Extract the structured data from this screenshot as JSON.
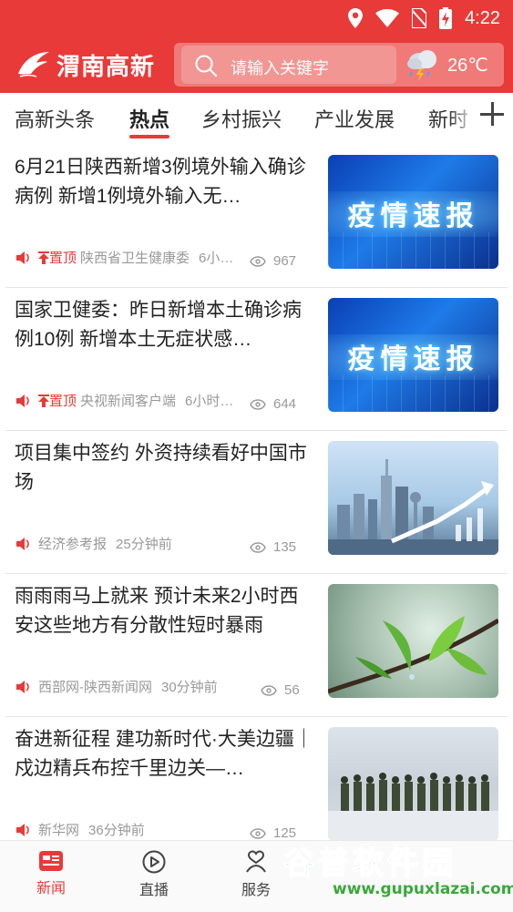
{
  "status_bar": {
    "time": "4:22"
  },
  "header": {
    "logo_text": "渭南高新",
    "search_placeholder": "请输入关键字",
    "temperature": "26℃",
    "brand_color": "#e83a38"
  },
  "tabs": [
    {
      "label": "高新头条",
      "active": false
    },
    {
      "label": "热点",
      "active": true
    },
    {
      "label": "乡村振兴",
      "active": false
    },
    {
      "label": "产业发展",
      "active": false
    },
    {
      "label": "新时",
      "active": false
    }
  ],
  "articles": [
    {
      "title": "6月21日陕西新增3例境外输入确诊病例 新增1例境外输入无…",
      "pinned_label": "置顶",
      "source": "陕西省卫生健康委",
      "time": "6小…",
      "views": "967",
      "thumb_text": "疫情速报"
    },
    {
      "title": "国家卫健委：昨日新增本土确诊病例10例 新增本土无症状感…",
      "pinned_label": "置顶",
      "source": "央视新闻客户端",
      "time": "6小时…",
      "views": "644",
      "thumb_text": "疫情速报"
    },
    {
      "title": "项目集中签约 外资持续看好中国市场",
      "pinned_label": "",
      "source": "经济参考报",
      "time": "25分钟前",
      "views": "135",
      "thumb_text": ""
    },
    {
      "title": "雨雨雨马上就来 预计未来2小时西安这些地方有分散性短时暴雨",
      "pinned_label": "",
      "source": "西部网-陕西新闻网",
      "time": "30分钟前",
      "views": "56",
      "thumb_text": ""
    },
    {
      "title": "奋进新征程 建功新时代·大美边疆｜戍边精兵布控千里边关—…",
      "pinned_label": "",
      "source": "新华网",
      "time": "36分钟前",
      "views": "125",
      "thumb_text": ""
    }
  ],
  "bottom_nav": [
    {
      "label": "新闻",
      "icon": "news-icon",
      "active": true
    },
    {
      "label": "直播",
      "icon": "play-icon",
      "active": false
    },
    {
      "label": "服务",
      "icon": "heart-hand-icon",
      "active": false
    }
  ],
  "watermark": {
    "text": "谷普软件园",
    "url": "www.gupuxlazai.com"
  }
}
